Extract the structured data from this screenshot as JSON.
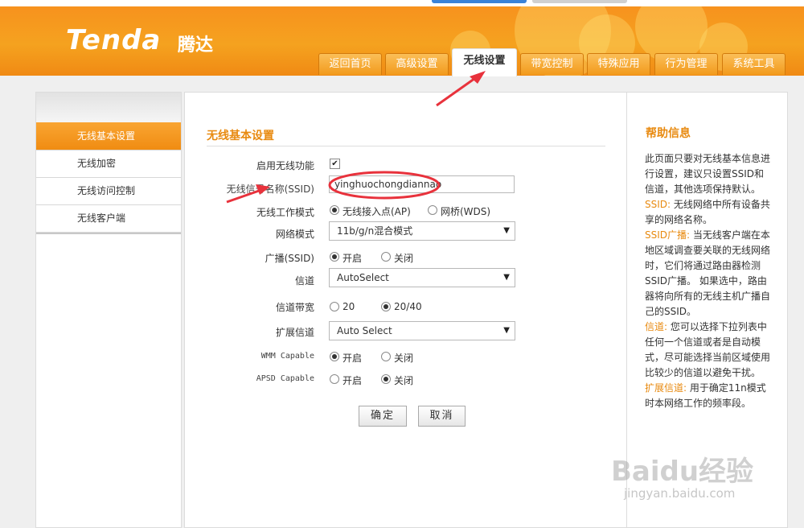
{
  "brand": {
    "logo": "Tenda",
    "logo_cn": "腾达"
  },
  "nav": {
    "tabs": [
      {
        "label": "返回首页"
      },
      {
        "label": "高级设置"
      },
      {
        "label": "无线设置",
        "active": true
      },
      {
        "label": "带宽控制"
      },
      {
        "label": "特殊应用"
      },
      {
        "label": "行为管理"
      },
      {
        "label": "系统工具"
      }
    ]
  },
  "sidebar": {
    "items": [
      {
        "label": "无线基本设置",
        "active": true
      },
      {
        "label": "无线加密"
      },
      {
        "label": "无线访问控制"
      },
      {
        "label": "无线客户端"
      }
    ]
  },
  "form": {
    "section_title": "无线基本设置",
    "enable_label": "启用无线功能",
    "enable_checked": true,
    "enable_mark": "✔",
    "ssid_label": "无线信号名称(SSID)",
    "ssid_value": "yinghuochongdiannao",
    "mode_label": "无线工作模式",
    "mode_options": [
      "无线接入点(AP)",
      "网桥(WDS)"
    ],
    "mode_selected": "无线接入点(AP)",
    "network_mode_label": "网络模式",
    "network_mode_value": "11b/g/n混合模式",
    "broadcast_label": "广播(SSID)",
    "broadcast_options": [
      "开启",
      "关闭"
    ],
    "broadcast_selected": "开启",
    "channel_label": "信道",
    "channel_value": "AutoSelect",
    "bandwidth_label": "信道带宽",
    "bandwidth_options": [
      "20",
      "20/40"
    ],
    "bandwidth_selected": "20/40",
    "ext_channel_label": "扩展信道",
    "ext_channel_value": "Auto Select",
    "wmm_label": "WMM Capable",
    "wmm_options": [
      "开启",
      "关闭"
    ],
    "wmm_selected": "开启",
    "apsd_label": "APSD Capable",
    "apsd_options": [
      "开启",
      "关闭"
    ],
    "apsd_selected": "关闭",
    "ok_label": "确定",
    "cancel_label": "取消",
    "dropdown_glyph": "▼"
  },
  "help": {
    "title": "帮助信息",
    "intro": "此页面只要对无线基本信息进行设置，建议只设置SSID和信道，其他选项保持默认。",
    "items": [
      {
        "term": "SSID:",
        "text": "无线网络中所有设备共享的网络名称。"
      },
      {
        "term": "SSID广播:",
        "text": "当无线客户端在本地区域调查要关联的无线网络时，它们将通过路由器检测SSID广播。 如果选中，路由器将向所有的无线主机广播自己的SSID。"
      },
      {
        "term": "信道:",
        "text": "您可以选择下拉列表中任何一个信道或者是自动模式，尽可能选择当前区域使用比较少的信道以避免干扰。"
      },
      {
        "term": "扩展信道:",
        "text": "用于确定11n模式时本网络工作的频率段。"
      }
    ]
  },
  "watermark": {
    "text": "Baidu经验",
    "url": "jingyan.baidu.com"
  },
  "colors": {
    "accent": "#f08c12",
    "annotation": "#e8323c",
    "nav_orange": "#f5a21f"
  },
  "icons": {
    "checkbox": "check-icon",
    "dropdown": "chevron-down-icon",
    "arrow": "arrow-annotation-icon"
  }
}
